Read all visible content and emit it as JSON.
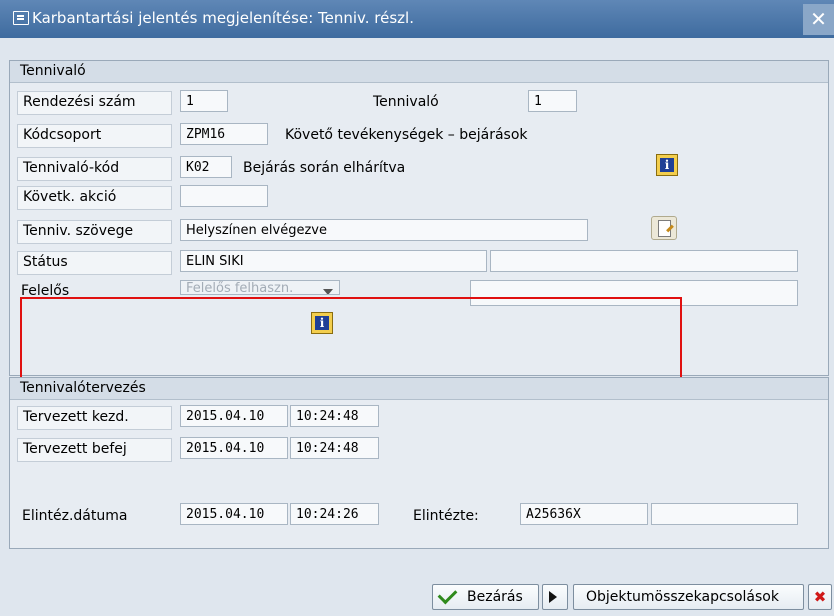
{
  "window": {
    "title": "Karbantartási jelentés megjelenítése: Tenniv. részl.",
    "close_glyph": "✕"
  },
  "tennivalo_group": {
    "title": "Tennivaló",
    "rendezesi_szam_label": "Rendezési szám",
    "rendezesi_szam_value": "1",
    "tennivalo_label": "Tennivaló",
    "tennivalo_value": "1",
    "kodcsoport_label": "Kódcsoport",
    "kodcsoport_value": "ZPM16",
    "kodcsoport_text": "Követő tevékenységek – bejárások",
    "tennivalo_kod_label": "Tennivaló-kód",
    "tennivalo_kod_value": "K02",
    "tennivalo_kod_text": "Bejárás során elhárítva",
    "kovetk_akcio_label": "Követk. akció",
    "kovetk_akcio_value": "",
    "szoveg_label": "Tenniv. szövege",
    "szoveg_value": "Helyszínen elvégezve",
    "status_label": "Státus",
    "status_value": "ELIN SIKI",
    "status_value2": "",
    "felelos_label": "Felelős",
    "felelos_dropdown": "Felelős felhaszn.",
    "felelos_value": ""
  },
  "tervezes_group": {
    "title": "Tennivalótervezés",
    "kezd_label": "Tervezett kezd.",
    "kezd_date": "2015.04.10",
    "kezd_time": "10:24:48",
    "befej_label": "Tervezett befej",
    "befej_date": "2015.04.10",
    "befej_time": "10:24:48",
    "elintez_label": "Elintéz.dátuma",
    "elintez_date": "2015.04.10",
    "elintez_time": "10:24:26",
    "elintezte_label": "Elintézte:",
    "elintezte_value": "A25636X",
    "elintezte_value2": ""
  },
  "footer": {
    "close_label": "Bezárás",
    "links_label": "Objektumösszekapcsolások",
    "cancel_glyph": "✖"
  },
  "colors": {
    "title_bar": "#4a76a8",
    "highlight_box": "#e01010",
    "info_icon": "#1f3f96",
    "check": "#2f8a1c",
    "cancel": "#d01818"
  }
}
